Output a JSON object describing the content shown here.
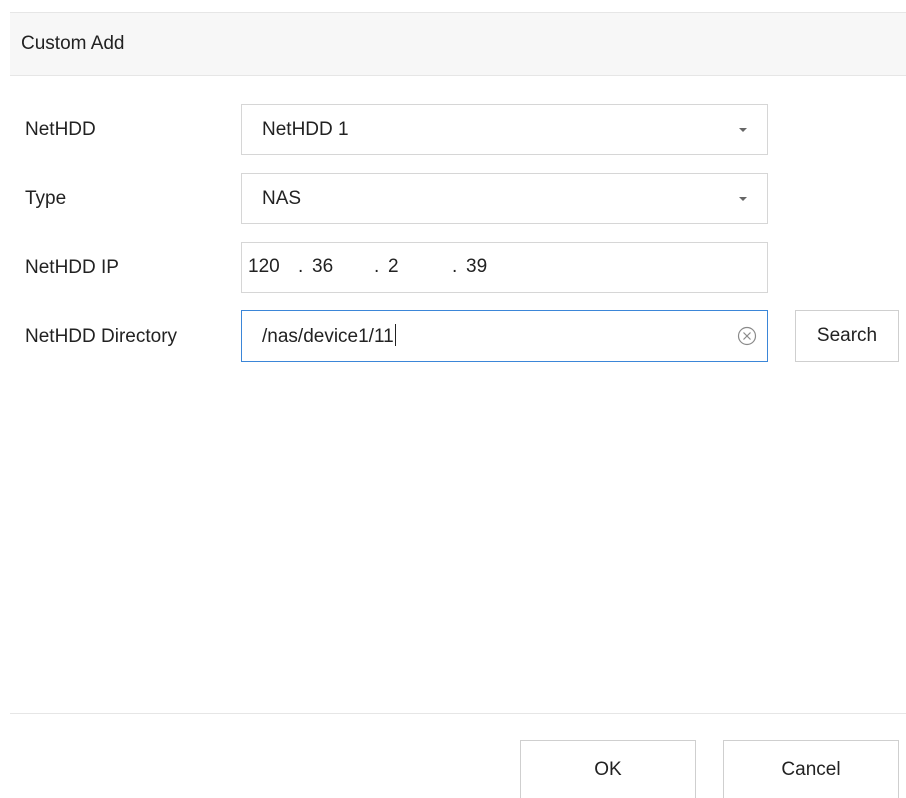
{
  "dialog": {
    "title": "Custom Add"
  },
  "form": {
    "nethdd": {
      "label": "NetHDD",
      "value": "NetHDD 1"
    },
    "type": {
      "label": "Type",
      "value": "NAS"
    },
    "ip": {
      "label": "NetHDD IP",
      "seg1": "120",
      "seg2": "36",
      "seg3": "2",
      "seg4": "39"
    },
    "directory": {
      "label": "NetHDD Directory",
      "value": "/nas/device1/11"
    },
    "search_label": "Search"
  },
  "footer": {
    "ok_label": "OK",
    "cancel_label": "Cancel"
  },
  "icons": {
    "dropdown": "chevron-down-icon",
    "clear": "clear-circle-x-icon"
  },
  "colors": {
    "focus_border": "#3b86d8",
    "header_bg": "#f7f7f7"
  }
}
